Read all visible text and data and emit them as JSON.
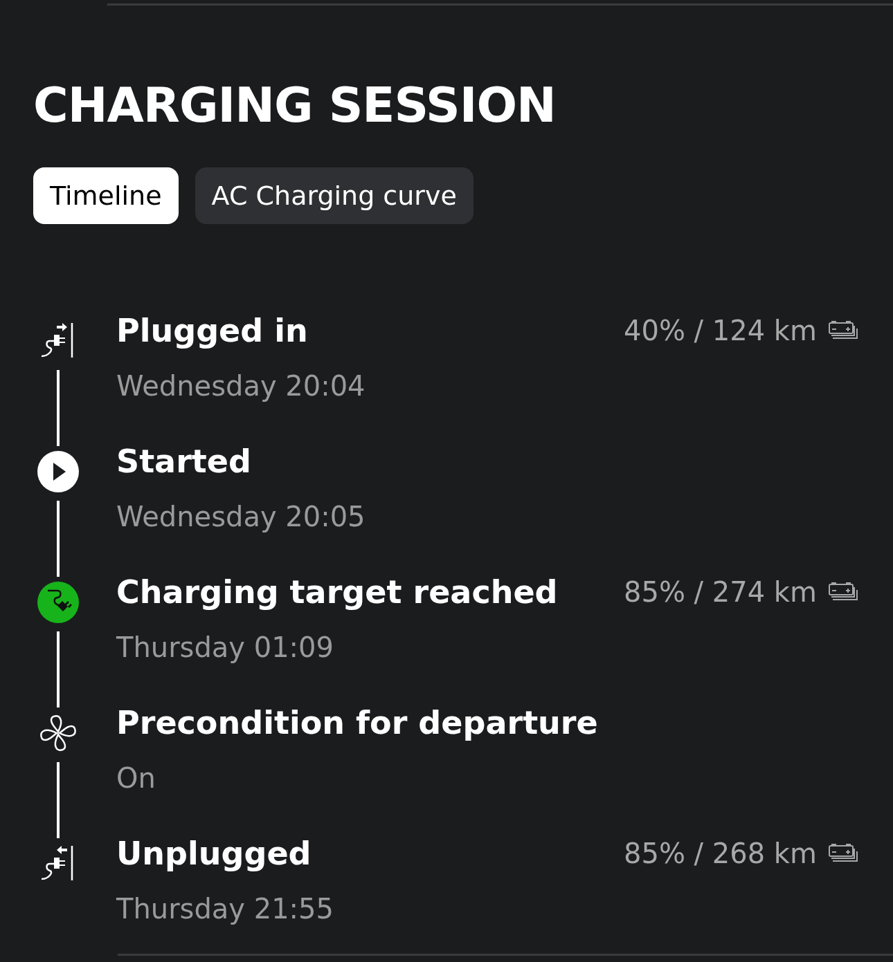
{
  "title": "CHARGING SESSION",
  "tabs": [
    {
      "label": "Timeline",
      "selected": true
    },
    {
      "label": "AC Charging curve",
      "selected": false
    }
  ],
  "events": [
    {
      "kind": "plug-in",
      "title": "Plugged in",
      "time": "Wednesday 20:04",
      "reading": "40% / 124 km"
    },
    {
      "kind": "start",
      "title": "Started",
      "time": "Wednesday 20:05"
    },
    {
      "kind": "target",
      "title": "Charging target reached",
      "time": "Thursday 01:09",
      "reading": "85% / 274 km"
    },
    {
      "kind": "fan",
      "title": "Precondition for departure",
      "time": "On"
    },
    {
      "kind": "unplug",
      "title": "Unplugged",
      "time": "Thursday 21:55",
      "reading": "85% / 268 km"
    }
  ]
}
